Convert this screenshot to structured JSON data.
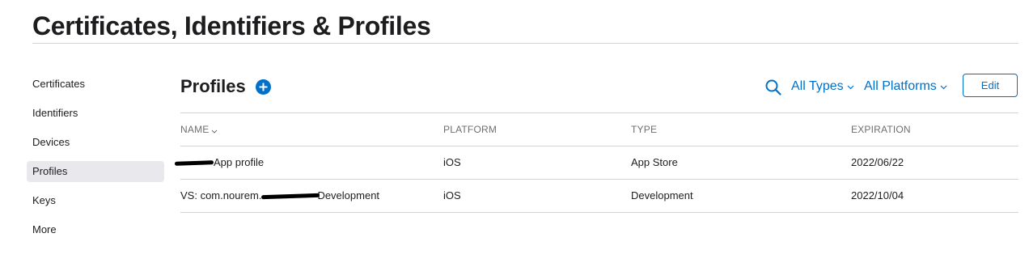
{
  "page": {
    "title": "Certificates, Identifiers & Profiles"
  },
  "sidebar": {
    "items": [
      {
        "label": "Certificates",
        "active": false
      },
      {
        "label": "Identifiers",
        "active": false
      },
      {
        "label": "Devices",
        "active": false
      },
      {
        "label": "Profiles",
        "active": true
      },
      {
        "label": "Keys",
        "active": false
      },
      {
        "label": "More",
        "active": false
      }
    ]
  },
  "main": {
    "title": "Profiles",
    "add_icon": "plus-circle-icon",
    "search_icon": "search-icon",
    "filters": {
      "types": "All Types",
      "platforms": "All Platforms"
    },
    "edit_label": "Edit",
    "accent_color": "#0070c9"
  },
  "table": {
    "columns": [
      "NAME",
      "PLATFORM",
      "TYPE",
      "EXPIRATION"
    ],
    "rows": [
      {
        "name_prefix": "",
        "name_suffix": "App profile",
        "platform": "iOS",
        "type": "App Store",
        "expiration": "2022/06/22"
      },
      {
        "name_prefix": "VS: com.nourem.",
        "name_suffix": "Development",
        "platform": "iOS",
        "type": "Development",
        "expiration": "2022/10/04"
      }
    ]
  }
}
